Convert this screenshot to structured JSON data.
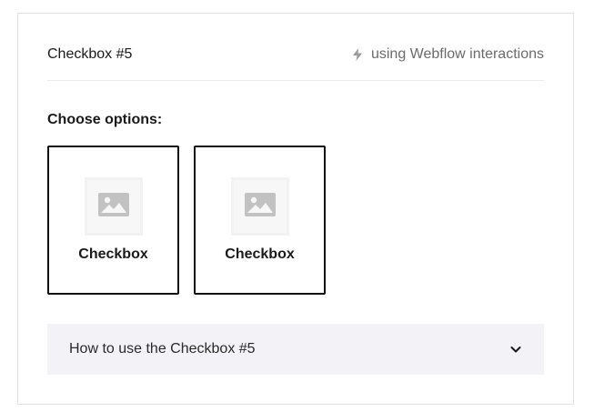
{
  "header": {
    "title": "Checkbox #5",
    "meta_text": "using Webflow interactions",
    "meta_icon": "lightning-bolt-icon"
  },
  "options": {
    "label": "Choose options:",
    "items": [
      {
        "label": "Checkbox",
        "icon": "image-placeholder-icon"
      },
      {
        "label": "Checkbox",
        "icon": "image-placeholder-icon"
      }
    ]
  },
  "accordion": {
    "title": "How to use the Checkbox #5",
    "icon": "chevron-down-icon"
  },
  "colors": {
    "border": "#111111",
    "accordion_bg": "#f2f2f7",
    "muted_text": "#6b6b6b"
  }
}
